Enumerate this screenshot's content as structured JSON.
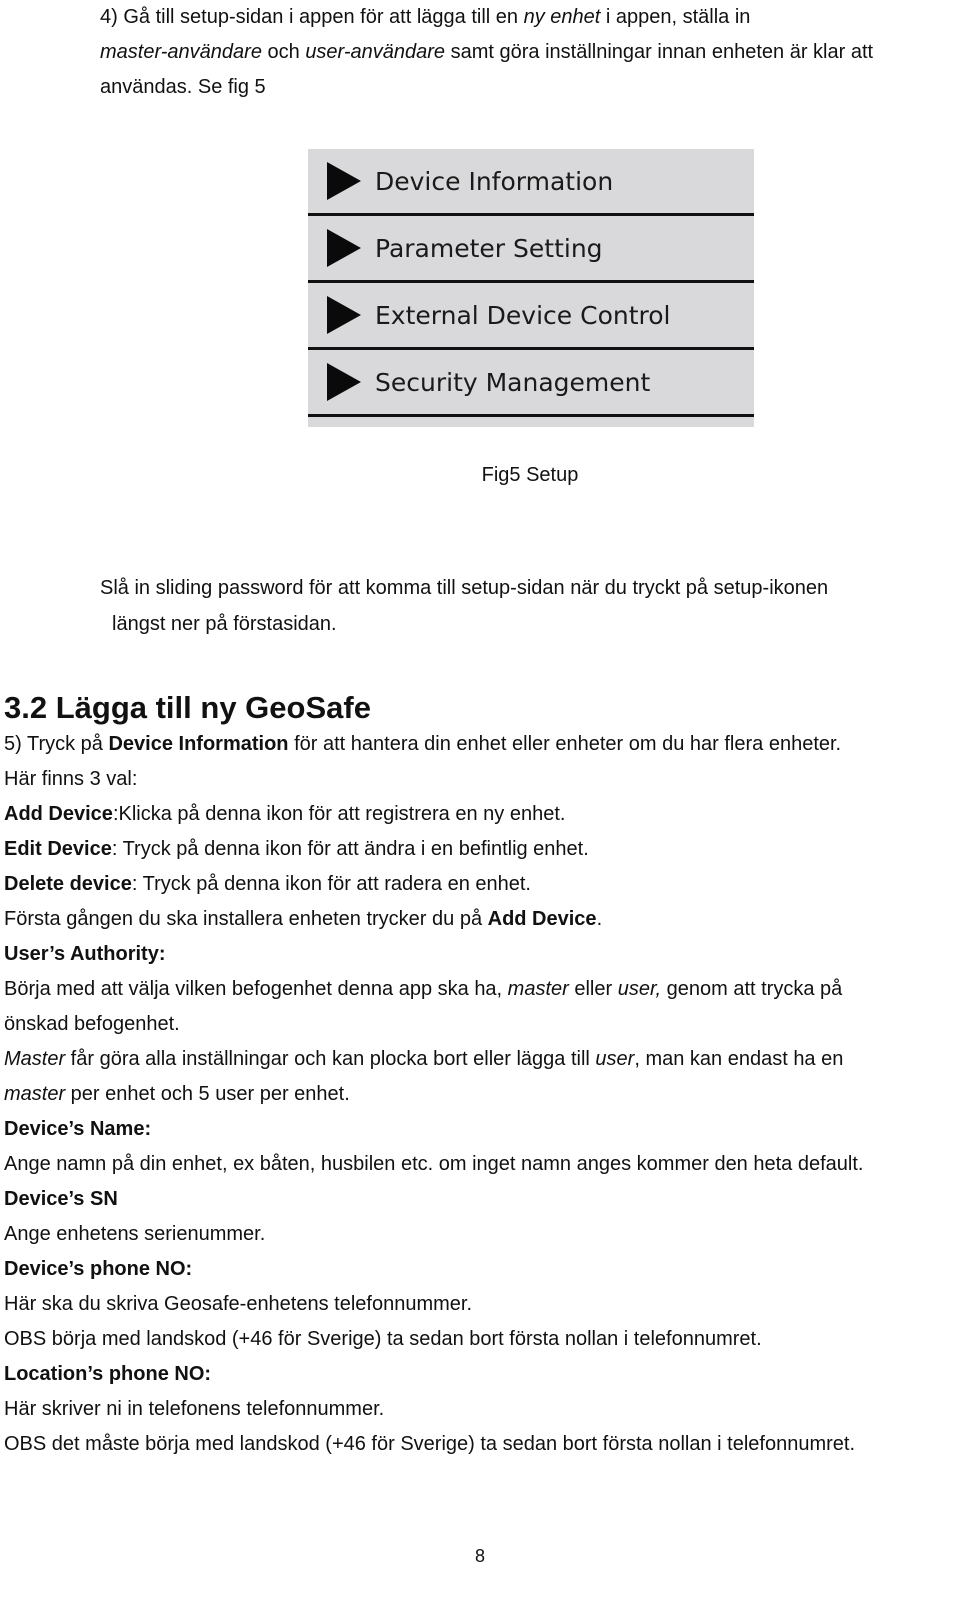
{
  "intro": {
    "line1_a": "4) Gå till setup-sidan i appen för att lägga till en ",
    "line1_em": "ny enhet",
    "line1_b": " i appen, ställa in",
    "line2_em1": "master-användare",
    "line2_a": " och ",
    "line2_em2": "user-användare",
    "line2_b": " samt göra inställningar innan enheten är klar att",
    "line3": "användas. Se fig 5"
  },
  "figure": {
    "menu_items": [
      {
        "label": "Device Information",
        "icon": "play-triangle-icon"
      },
      {
        "label": "Parameter Setting",
        "icon": "play-triangle-icon"
      },
      {
        "label": "External Device Control",
        "icon": "play-triangle-icon"
      },
      {
        "label": "Security Management",
        "icon": "play-triangle-icon"
      }
    ],
    "caption": "Fig5 Setup",
    "background_color": "#d9d9db"
  },
  "note": {
    "line1": "Slå in sliding password för att komma till setup-sidan när du tryckt på setup-ikonen",
    "line2": "längst ner på förstasidan."
  },
  "section": {
    "heading": "3.2 Lägga till ny GeoSafe",
    "p1_a": "5) Tryck på ",
    "p1_b": "Device Information",
    "p1_c": " för att hantera din enhet eller enheter om du har flera enheter.",
    "p2": "Här finns 3 val:",
    "add_term": "Add Device",
    "add_desc": ":Klicka på denna ikon för att registrera en ny enhet.",
    "edit_term": "Edit Device",
    "edit_desc": ": Tryck på denna ikon för att ändra i en befintlig enhet.",
    "delete_term": "Delete device",
    "delete_desc": ": Tryck på denna ikon för att radera en enhet.",
    "first_a": "Första gången du ska installera enheten trycker du på ",
    "first_b": "Add Device",
    "first_c": ".",
    "authority_heading": "User’s Authority:",
    "auth1_a": "Börja med att välja vilken befogenhet denna app ska ha, ",
    "auth1_em1": "master",
    "auth1_b": " eller ",
    "auth1_em2": "user,",
    "auth1_c": " genom att trycka på",
    "auth2": "önskad befogenhet.",
    "master1_em": "Master",
    "master1_a": " får göra alla inställningar och kan plocka bort eller lägga till ",
    "master1_em2": "user",
    "master1_b": ", man kan endast ha en",
    "master2_em": "master",
    "master2_a": " per enhet och 5 user per enhet.",
    "name_heading": "Device’s Name:",
    "name_desc": "Ange namn på din enhet, ex båten, husbilen etc. om inget namn anges kommer den heta default.",
    "sn_heading": "Device’s SN",
    "sn_desc": "Ange enhetens serienummer.",
    "phone_heading": "Device’s phone NO:",
    "phone_desc": "Här ska du skriva Geosafe-enhetens telefonnummer.",
    "phone_obs": "OBS börja med landskod (+46 för Sverige) ta sedan bort första nollan i telefonnumret.",
    "loc_heading": "Location’s phone NO:",
    "loc_desc": "Här skriver ni in telefonens telefonnummer.",
    "loc_obs": "OBS det måste börja med landskod (+46 för Sverige) ta sedan bort första nollan i telefonnumret."
  },
  "page_number": "8"
}
